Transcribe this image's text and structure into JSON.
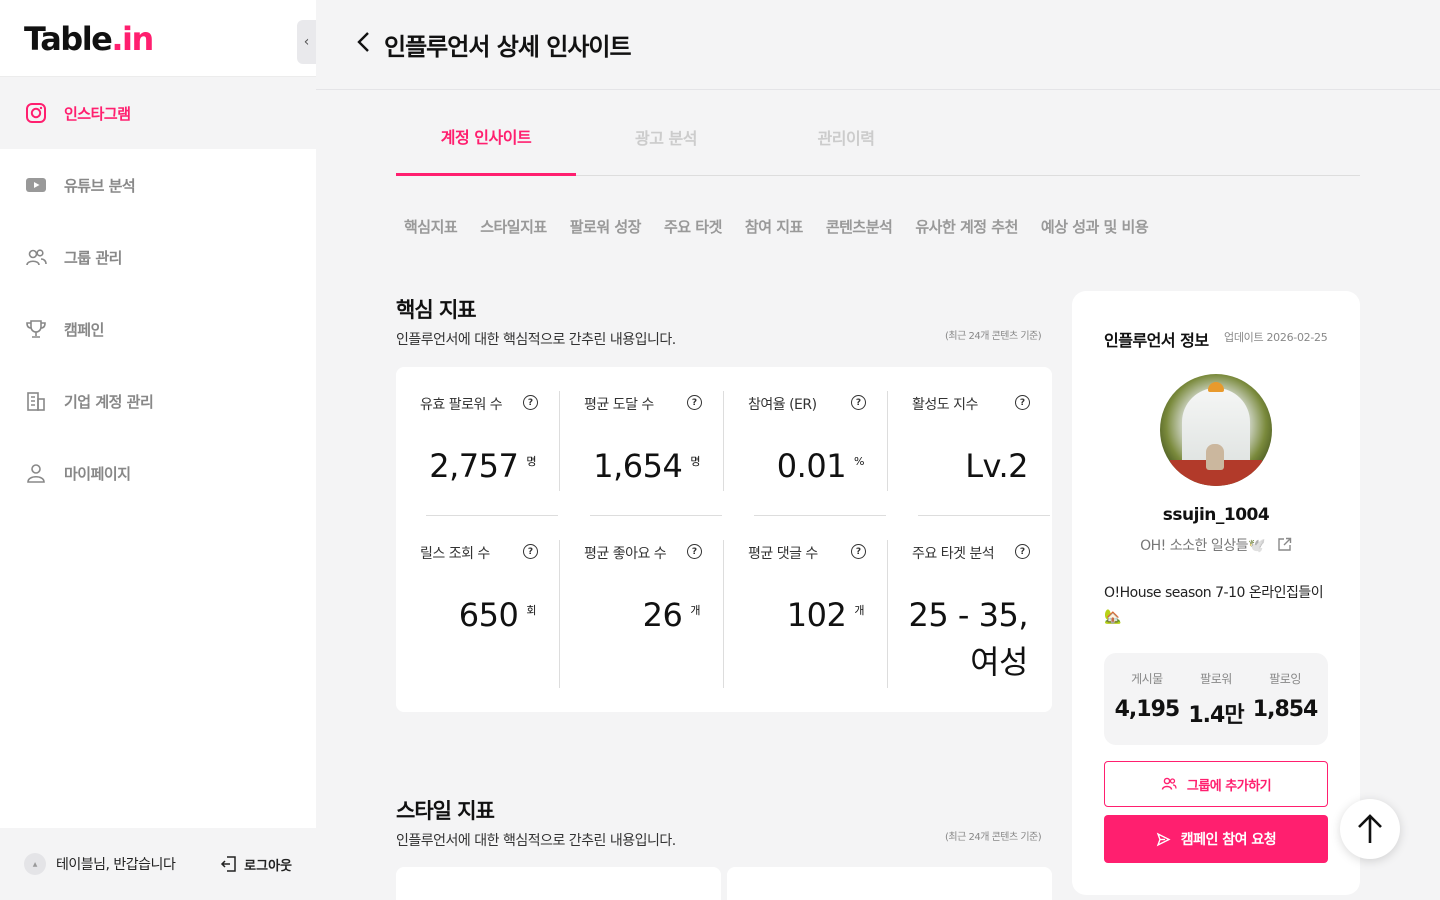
{
  "brand": {
    "logo_main": "Table",
    "logo_dot": ".",
    "logo_accent": "in",
    "accent_color": "#ff1f6f"
  },
  "sidebar": {
    "items": [
      {
        "label": "인스타그램",
        "icon": "instagram-icon",
        "active": true
      },
      {
        "label": "유튜브 분석",
        "icon": "youtube-icon"
      },
      {
        "label": "그룹 관리",
        "icon": "group-icon"
      },
      {
        "label": "캠페인",
        "icon": "trophy-icon"
      },
      {
        "label": "기업 계정 관리",
        "icon": "building-icon"
      },
      {
        "label": "마이페이지",
        "icon": "user-icon"
      }
    ],
    "greeting": "테이블님, 반갑습니다",
    "logout_label": "로그아웃"
  },
  "header": {
    "title": "인플루언서 상세 인사이트"
  },
  "tabs": [
    "계정 인사이트",
    "광고 분석",
    "관리이력"
  ],
  "subtabs": [
    "핵심지표",
    "스타일지표",
    "팔로워 성장",
    "주요 타겟",
    "참여 지표",
    "콘텐츠분석",
    "유사한 계정 추천",
    "예상 성과 및 비용"
  ],
  "core_section": {
    "title": "핵심 지표",
    "desc": "인플루언서에 대한 핵심적으로 간추린 내용입니다.",
    "note": "(최근 24개 콘텐츠 기준)",
    "metrics": [
      {
        "label": "유효 팔로워 수",
        "value": "2,757",
        "unit": "명"
      },
      {
        "label": "평균 도달 수",
        "value": "1,654",
        "unit": "명"
      },
      {
        "label": "참여율 (ER)",
        "value": "0.01",
        "unit": "%"
      },
      {
        "label": "활성도 지수",
        "value": "Lv.2",
        "unit": ""
      },
      {
        "label": "릴스 조회 수",
        "value": "650",
        "unit": "회"
      },
      {
        "label": "평균 좋아요 수",
        "value": "26",
        "unit": "개"
      },
      {
        "label": "평균 댓글 수",
        "value": "102",
        "unit": "개"
      },
      {
        "label": "주요 타겟 분석",
        "value": "25 - 35,",
        "value2": "여성",
        "unit": ""
      }
    ]
  },
  "style_section": {
    "title": "스타일 지표",
    "desc": "인플루언서에 대한 핵심적으로 간추린 내용입니다.",
    "note": "(최근 24개 콘텐츠 기준)"
  },
  "influencer": {
    "panel_title": "인플루언서 정보",
    "updated": "업데이트 2026-02-25",
    "username": "ssujin_1004",
    "bio_title": "OH! 소소한 일상들🕊️",
    "bio": "O!House season 7-10 온라인집들이🏡",
    "stats": [
      {
        "label": "게시물",
        "value": "4,195"
      },
      {
        "label": "팔로워",
        "value": "1.4만"
      },
      {
        "label": "팔로잉",
        "value": "1,854"
      }
    ],
    "add_group_label": "그룹에 추가하기",
    "campaign_label": "캠페인 참여 요청"
  }
}
